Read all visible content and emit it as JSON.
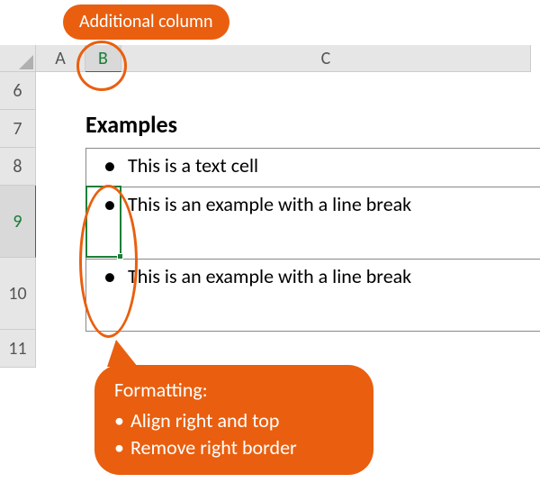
{
  "callouts": {
    "top": "Additional column",
    "bottom": {
      "title": "Formatting:",
      "items": [
        "Align right and top",
        "Remove right border"
      ]
    }
  },
  "columns": {
    "a": "A",
    "b": "B",
    "c": "C"
  },
  "rows": {
    "r6": "6",
    "r7": "7",
    "r8": "8",
    "r9": "9",
    "r10": "10",
    "r11": "11"
  },
  "content": {
    "title": "Examples",
    "bullet": "•",
    "items": [
      "This is a text cell",
      "This is an example with a line break",
      "This is an example with a line break"
    ]
  }
}
